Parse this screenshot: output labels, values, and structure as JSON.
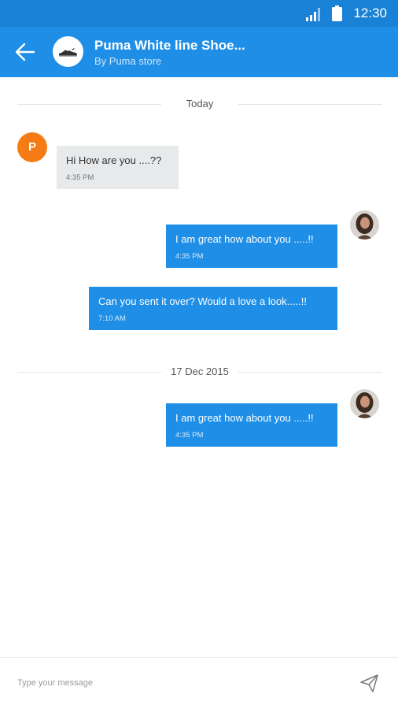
{
  "status_bar": {
    "time": "12:30",
    "icons": [
      "signal-icon",
      "battery-icon"
    ]
  },
  "app_bar": {
    "back_icon": "back-arrow-icon",
    "product_title": "Puma White line Shoe...",
    "product_subtitle": "By Puma store"
  },
  "conversation": {
    "date_dividers": [
      "Today",
      "17 Dec 2015"
    ],
    "sender_initial": "P",
    "messages": [
      {
        "direction": "incoming",
        "text": "Hi How are you ....??",
        "time": "4:35 PM"
      },
      {
        "direction": "outgoing",
        "text": "I am great how about you .....!!",
        "time": "4:35 PM"
      },
      {
        "direction": "outgoing",
        "text": "Can you sent it over? Would a love a look.....!!",
        "time": "7:10 AM"
      },
      {
        "direction": "outgoing",
        "text": "I am great how about you .....!!",
        "time": "4:35 PM"
      }
    ]
  },
  "composer": {
    "placeholder": "Type your message",
    "value": "",
    "send_icon": "send-icon"
  },
  "colors": {
    "status_bar": "#1a82d6",
    "app_bar": "#1e8ee6",
    "outgoing_bubble": "#1e8ee6",
    "incoming_bubble": "#e7e9eb",
    "sender_avatar": "#f57c14"
  }
}
